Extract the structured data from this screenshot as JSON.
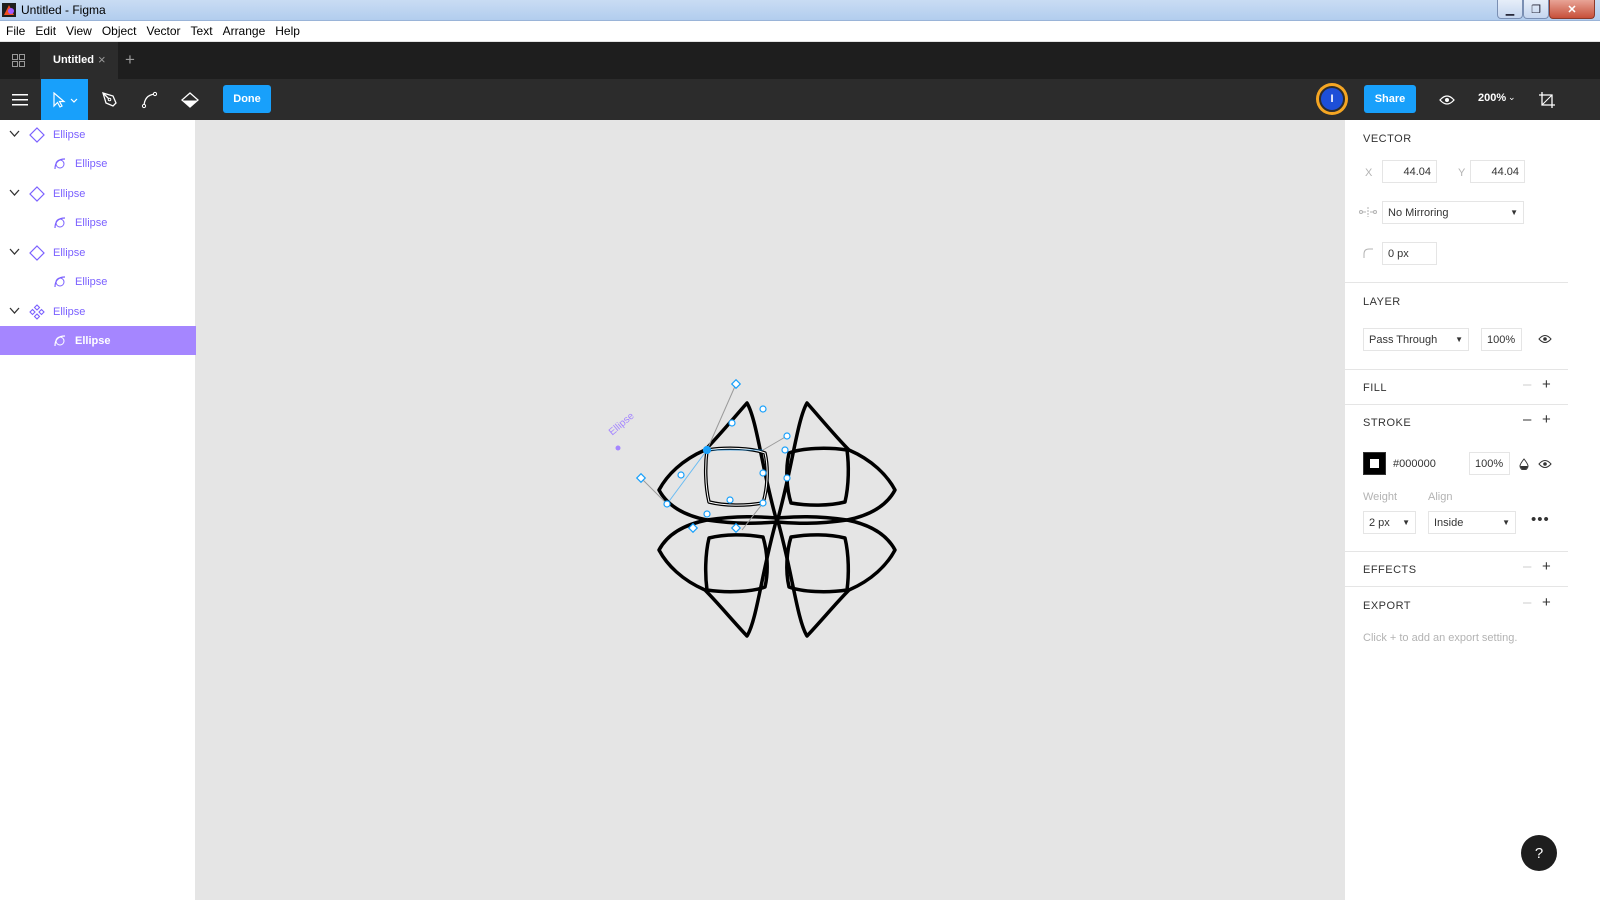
{
  "window": {
    "title": "Untitled - Figma",
    "min": "▁",
    "max": "❐",
    "close": "✕"
  },
  "menu": [
    "File",
    "Edit",
    "View",
    "Object",
    "Vector",
    "Text",
    "Arrange",
    "Help"
  ],
  "tabs": {
    "active": "Untitled",
    "close": "×",
    "add": "+"
  },
  "toolbar": {
    "done_label": "Done",
    "share_label": "Share",
    "avatar_initial": "I",
    "zoom": "200%",
    "accent": "#18a0fb"
  },
  "layers": [
    {
      "name": "Ellipse",
      "level": 0,
      "icon": "component-icon",
      "expanded": true
    },
    {
      "name": "Ellipse",
      "level": 1,
      "icon": "vector-icon"
    },
    {
      "name": "Ellipse",
      "level": 0,
      "icon": "component-icon",
      "expanded": true
    },
    {
      "name": "Ellipse",
      "level": 1,
      "icon": "vector-icon"
    },
    {
      "name": "Ellipse",
      "level": 0,
      "icon": "component-icon",
      "expanded": true
    },
    {
      "name": "Ellipse",
      "level": 1,
      "icon": "vector-icon"
    },
    {
      "name": "Ellipse",
      "level": 0,
      "icon": "master-component-icon",
      "expanded": true
    },
    {
      "name": "Ellipse",
      "level": 1,
      "icon": "vector-icon",
      "selected": true
    }
  ],
  "canvas": {
    "selection_label": "Ellipse",
    "selection_color": "#a586ff"
  },
  "properties": {
    "vector": {
      "title": "VECTOR",
      "x_label": "X",
      "x": "44.04",
      "y_label": "Y",
      "y": "44.04",
      "mirroring": "No Mirroring",
      "corner_radius": "0 px"
    },
    "layer": {
      "title": "LAYER",
      "blend_mode": "Pass Through",
      "opacity": "100%"
    },
    "fill": {
      "title": "FILL"
    },
    "stroke": {
      "title": "STROKE",
      "color": "#000000",
      "opacity": "100%",
      "weight_label": "Weight",
      "weight": "2 px",
      "align_label": "Align",
      "align": "Inside"
    },
    "effects": {
      "title": "EFFECTS"
    },
    "export": {
      "title": "EXPORT",
      "hint": "Click + to add an export setting."
    }
  },
  "help": "?"
}
